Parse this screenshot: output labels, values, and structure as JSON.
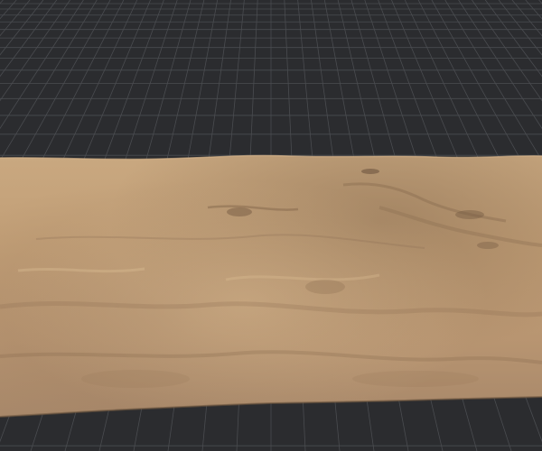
{
  "viewport": {
    "background_color": "#2b2c2f",
    "grid_color": "#4a4c50",
    "grid_visible": true
  },
  "terrain": {
    "surface_color": "#c4a07a",
    "highlight_color": "#d8b68d",
    "shadow_color": "#8a6c50"
  }
}
